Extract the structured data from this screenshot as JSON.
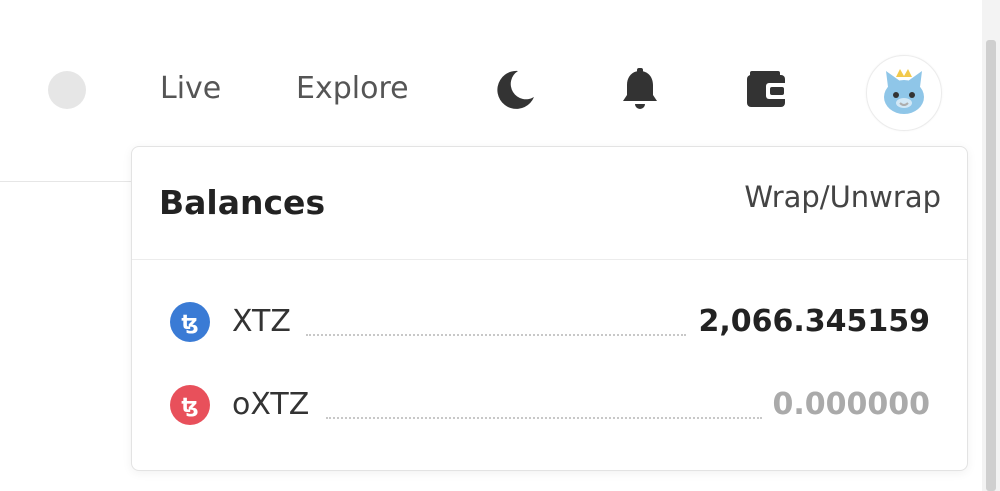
{
  "nav": {
    "live_label": "Live",
    "explore_label": "Explore",
    "icons": [
      "moon-icon",
      "bell-icon",
      "wallet-icon",
      "cat-avatar"
    ]
  },
  "balances": {
    "title": "Balances",
    "wrap_link": "Wrap/Unwrap",
    "tokens": [
      {
        "symbol": "XTZ",
        "amount": "2,066.345159",
        "icon_color": "#3a7bd5"
      },
      {
        "symbol": "oXTZ",
        "amount": "0.000000",
        "icon_color": "#e8505b"
      }
    ]
  }
}
